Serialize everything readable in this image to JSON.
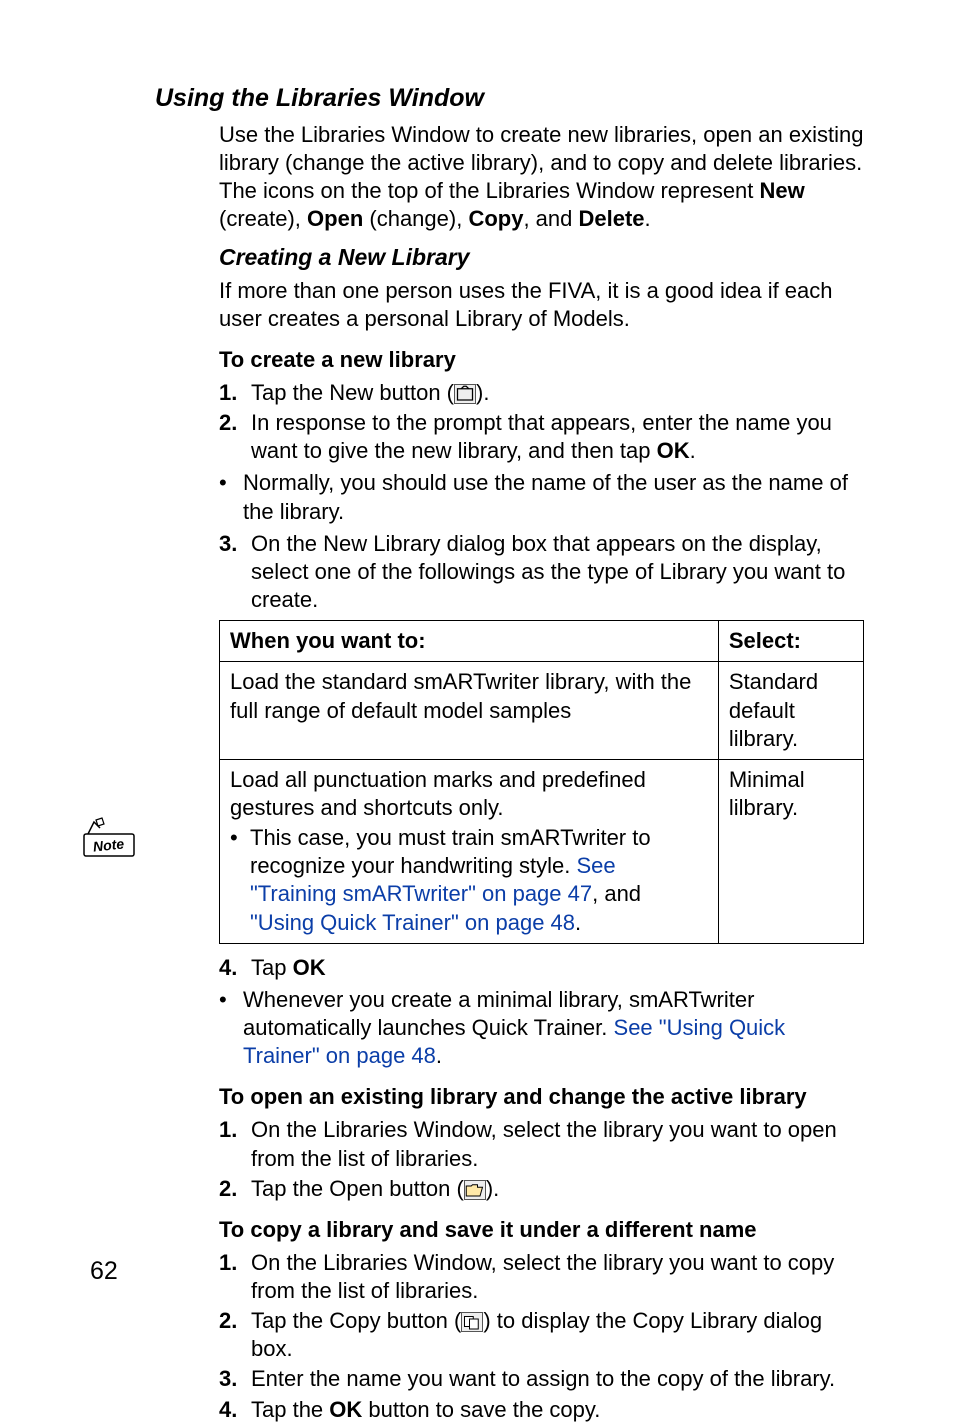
{
  "h1": "Using the Libraries Window",
  "intro_parts": {
    "a": "Use the Libraries Window to create new libraries, open an existing library (change the active library), and to copy and delete libraries. The icons on the top of the Libraries Window represent ",
    "new": "New",
    "b": " (create), ",
    "open": "Open",
    "c": " (change), ",
    "copy": "Copy",
    "d": ", and ",
    "delete": "Delete",
    "e": "."
  },
  "h2": "Creating a New Library",
  "p1": "If more than one person uses the FIVA, it is a good idea if each user creates a personal Library of Models.",
  "h3a": "To create a new library",
  "step1": {
    "num": "1.",
    "a": "Tap the New button (",
    "b": ")."
  },
  "step2": {
    "num": "2.",
    "a": "In response to the prompt that appears, enter the name you want to give the new library, and then tap ",
    "b": "OK",
    "c": "."
  },
  "bullet1": "Normally, you should use the name of the user as the name of the library.",
  "step3": {
    "num": "3.",
    "text": "On the New Library dialog box that appears on the display, select one of the followings as the type of Library you want to create."
  },
  "table": {
    "head": {
      "c1": "When you want to:",
      "c2": "Select:"
    },
    "row1": {
      "c1": "Load the standard smARTwriter library, with the full range of default model samples",
      "c2": "Standard default lilbrary."
    },
    "row2": {
      "c1a": "Load all punctuation marks and predefined gestures and shortcuts only.",
      "c1b_pre": "This case, you must train smARTwriter to recognize your handwriting style. ",
      "c1b_link1": "See \"Training smARTwriter\" on page 47",
      "c1b_mid": ", and ",
      "c1b_link2": "\"Using Quick Trainer\" on page 48",
      "c1b_end": ".",
      "c2": "Minimal lilbrary."
    }
  },
  "step4": {
    "num": "4.",
    "a": "Tap ",
    "b": "OK"
  },
  "bullet2": {
    "a": "Whenever you create a minimal library, smARTwriter automatically launches Quick Trainer. ",
    "link": "See \"Using Quick Trainer\" on page 48",
    "b": "."
  },
  "h3b": "To open an existing library and change the active library",
  "open_step1": {
    "num": "1.",
    "text": "On the Libraries Window, select the library you want to open from the list of libraries."
  },
  "open_step2": {
    "num": "2.",
    "a": "Tap the Open button (",
    "b": ")."
  },
  "h3c": "To copy a library and save it under a different name",
  "copy_step1": {
    "num": "1.",
    "text": "On the Libraries Window, select the library you want to copy from the list of libraries."
  },
  "copy_step2": {
    "num": "2.",
    "a": "Tap the Copy button (",
    "b": ") to display the Copy Library dialog box."
  },
  "copy_step3": {
    "num": "3.",
    "text": "Enter the name you want to assign to the copy of the library."
  },
  "copy_step4": {
    "num": "4.",
    "a": "Tap the ",
    "b": "OK",
    "c": " button to save the copy."
  },
  "page_number": "62"
}
